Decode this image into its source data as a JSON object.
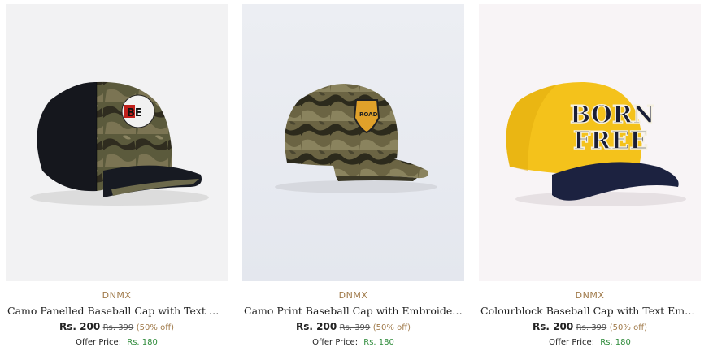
{
  "products": [
    {
      "brand": "DNMX",
      "title": "Camo Panelled Baseball Cap with Text Embroidery",
      "price": "Rs. 200",
      "mrp": "Rs. 399",
      "discount": "(50% off)",
      "offer_label": "Offer Price:",
      "offer_price": "Rs. 180",
      "patch_text": "BE"
    },
    {
      "brand": "DNMX",
      "title": "Camo Print Baseball Cap with Embroidery",
      "price": "Rs. 200",
      "mrp": "Rs. 399",
      "discount": "(50% off)",
      "offer_label": "Offer Price:",
      "offer_price": "Rs. 180",
      "patch_text": "ROAD"
    },
    {
      "brand": "DNMX",
      "title": "Colourblock Baseball Cap with Text Embroidery",
      "price": "Rs. 200",
      "mrp": "Rs. 399",
      "discount": "(50% off)",
      "offer_label": "Offer Price:",
      "offer_price": "Rs. 180",
      "patch_text_1": "BORN",
      "patch_text_2": "FREE"
    }
  ]
}
